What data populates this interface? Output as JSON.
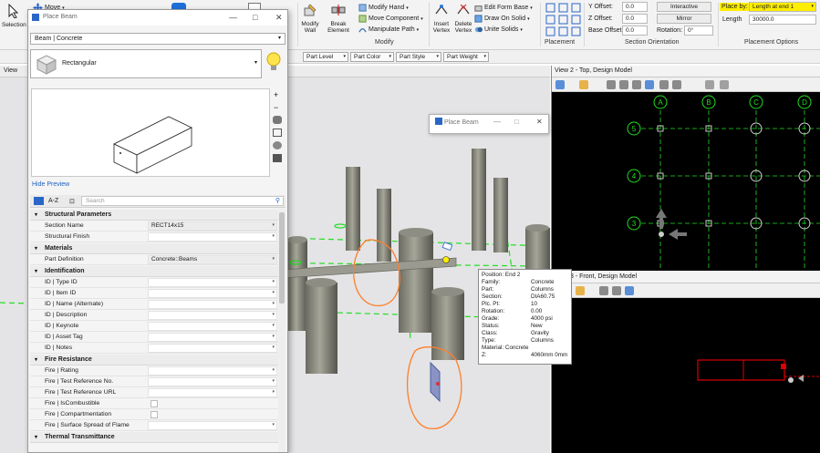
{
  "ribbon": {
    "select_label": "Selection",
    "move_label": "Move",
    "modify_wall_label": "Modify Wall",
    "break_element_label": "Break Element",
    "modify_hand_label": "Modify Hand",
    "move_component_label": "Move Component",
    "manipulate_path_label": "Manipulate Path",
    "insert_vertex_label": "Insert Vertex",
    "delete_vertex_label": "Delete Vertex",
    "edit_form_base_label": "Edit Form Base",
    "draw_on_solid_label": "Draw On Solid",
    "unite_solids_label": "Unite Solids",
    "modify_group": "Modify",
    "placement_group": "Placement",
    "y_offset_label": "Y Offset:",
    "y_offset_value": "0.0",
    "z_offset_label": "Z Offset:",
    "z_offset_value": "0.0",
    "base_offset_label": "Base Offset:",
    "base_offset_value": "0.0",
    "section_orientation_group": "Section Orientation",
    "interactive_label": "Interactive",
    "mirror_label": "Mirror",
    "rotation_label": "Rotation:",
    "rotation_value": "0°",
    "place_by_label": "Place by:",
    "place_by_value": "Length at end 1",
    "length_label": "Length",
    "length_value": "30000.0",
    "placement_options_group": "Placement Options"
  },
  "toolbar2": {
    "part_level": "Part Level",
    "part_color": "Part Color",
    "part_style": "Part Style",
    "part_weight": "Part Weight",
    "tab_view1": "View"
  },
  "dialog": {
    "title": "Place Beam",
    "type_value": "Beam | Concrete",
    "shape_value": "Rectangular",
    "hide_preview": "Hide Preview",
    "search_placeholder": "Search",
    "sort_az": "A-Z",
    "categories": {
      "structural_parameters": "Structural Parameters",
      "materials": "Materials",
      "identification": "Identification",
      "fire_resistance": "Fire Resistance",
      "thermal_transmittance": "Thermal Transmittance"
    },
    "rows": {
      "section_name": {
        "label": "Section Name",
        "value": "RECT14x15"
      },
      "structural_finish": {
        "label": "Structural Finish",
        "value": ""
      },
      "part_definition": {
        "label": "Part Definition",
        "value": "Concrete::Beams"
      },
      "type_id": {
        "label": "ID | Type ID"
      },
      "item_id": {
        "label": "ID | Item ID"
      },
      "name_alt": {
        "label": "ID | Name (Alternate)"
      },
      "description": {
        "label": "ID | Description"
      },
      "keynote": {
        "label": "ID | Keynote"
      },
      "asset_tag": {
        "label": "ID | Asset Tag"
      },
      "notes": {
        "label": "ID | Notes"
      },
      "fire_rating": {
        "label": "Fire | Rating"
      },
      "fire_test_ref": {
        "label": "Fire | Test Reference No."
      },
      "fire_test_url": {
        "label": "Fire | Test Reference URL"
      },
      "fire_combustible": {
        "label": "Fire | IsCombustible"
      },
      "fire_compartment": {
        "label": "Fire | Compartmentation"
      },
      "fire_spread": {
        "label": "Fire | Surface Spread of Flame"
      }
    }
  },
  "floating_dialog": {
    "title": "Place Beam"
  },
  "tooltip": {
    "position": "Position: End 2",
    "family_k": "Family:",
    "family_v": "Concrete",
    "part_k": "Part:",
    "part_v": "Columns",
    "section_k": "Section:",
    "section_v": "DIA60.75",
    "plcpt_k": "Plc. Pt:",
    "plcpt_v": "10",
    "rotation_k": "Rotation:",
    "rotation_v": "0.00",
    "grade_k": "Grade:",
    "grade_v": "4000 psi",
    "status_k": "Status:",
    "status_v": "New",
    "class_k": "Class:",
    "class_v": "Gravity",
    "type_k": "Type:",
    "type_v": "Columns",
    "material": "Material: Concrete",
    "z_k": "Z:",
    "z_v": "4060mm 0mm"
  },
  "view2": {
    "title": "View 2 - Top, Design Model",
    "grid_cols": [
      "A",
      "B",
      "C",
      "D"
    ],
    "grid_rows": [
      "5",
      "4",
      "3"
    ]
  },
  "view3": {
    "title": "View 3 - Front, Design Model"
  },
  "colors": {
    "grid_green": "#22dd22",
    "annotation_orange": "#ff7f2a",
    "highlight_yellow": "#ffee00",
    "beam_red": "#dd0000"
  }
}
